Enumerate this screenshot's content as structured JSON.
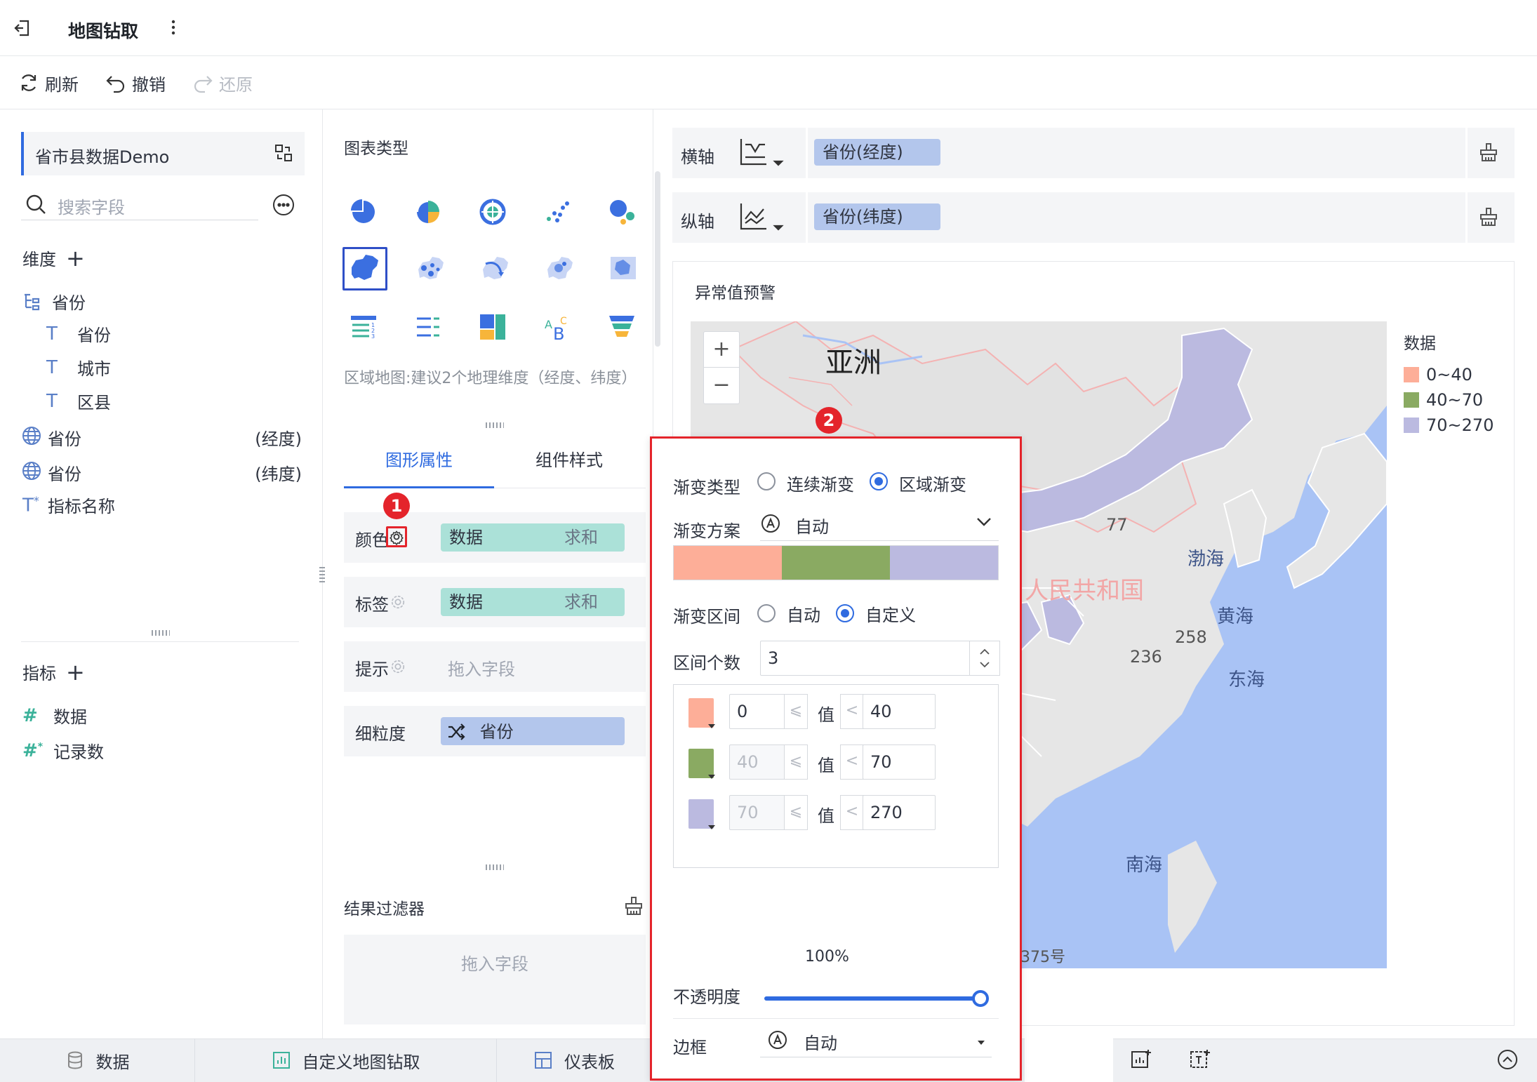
{
  "topbar": {
    "title": "地图钻取"
  },
  "toolbar": {
    "refresh": "刷新",
    "undo": "撤销",
    "redo": "还原"
  },
  "left": {
    "dataset": "省市县数据Demo",
    "search_placeholder": "搜索字段",
    "dimensions_label": "维度",
    "dimension_group": "省份",
    "dimension_children": [
      "省份",
      "城市",
      "区县"
    ],
    "geo_fields": [
      {
        "name": "省份",
        "tag": "(经度)"
      },
      {
        "name": "省份",
        "tag": "(纬度)"
      }
    ],
    "metric_name_field": "指标名称",
    "metrics_label": "指标",
    "metrics": [
      "数据",
      "记录数"
    ]
  },
  "middle": {
    "chart_type_label": "图表类型",
    "chart_hint": "区域地图:建议2个地理维度（经度、纬度）",
    "tabs": [
      "图形属性",
      "组件样式"
    ],
    "props": {
      "color": {
        "label": "颜色",
        "field": "数据",
        "agg": "求和"
      },
      "label": {
        "label": "标签",
        "field": "数据",
        "agg": "求和"
      },
      "tooltip": {
        "label": "提示",
        "placeholder": "拖入字段"
      },
      "granularity": {
        "label": "细粒度",
        "field": "省份"
      }
    },
    "filter": {
      "label": "结果过滤器",
      "placeholder": "拖入字段"
    }
  },
  "axes": {
    "x_label": "横轴",
    "x_field": "省份(经度)",
    "y_label": "纵轴",
    "y_field": "省份(纬度)"
  },
  "map": {
    "title": "异常值预警",
    "continent": "亚洲",
    "country": "人民共和国",
    "seas": [
      "渤海",
      "黄海",
      "东海",
      "南海"
    ],
    "values": [
      "77",
      "258",
      "236"
    ],
    "footer": "375号",
    "zoom_in": "+",
    "zoom_out": "−",
    "legend_title": "数据",
    "legend": [
      {
        "label": "0~40",
        "color": "#fdae98"
      },
      {
        "label": "40~70",
        "color": "#8aaa62"
      },
      {
        "label": "70~270",
        "color": "#bbbae0"
      }
    ]
  },
  "popup": {
    "gradient_type_label": "渐变类型",
    "gradient_type_options": [
      "连续渐变",
      "区域渐变"
    ],
    "scheme_label": "渐变方案",
    "scheme_value": "自动",
    "range_label": "渐变区间",
    "range_options": [
      "自动",
      "自定义"
    ],
    "count_label": "区间个数",
    "count_value": "3",
    "value_word": "值",
    "intervals": [
      {
        "color": "#fdae98",
        "from": "0",
        "to": "40"
      },
      {
        "color": "#8aaa62",
        "from": "40",
        "to": "70"
      },
      {
        "color": "#bbbae0",
        "from": "70",
        "to": "270"
      }
    ],
    "opacity_value": "100%",
    "opacity_level": 1.0,
    "opacity_label": "不透明度",
    "border_label": "边框",
    "border_value": "自动"
  },
  "badges": [
    "1",
    "2"
  ],
  "bottom_tabs": [
    "数据",
    "自定义地图钻取",
    "仪表板"
  ]
}
